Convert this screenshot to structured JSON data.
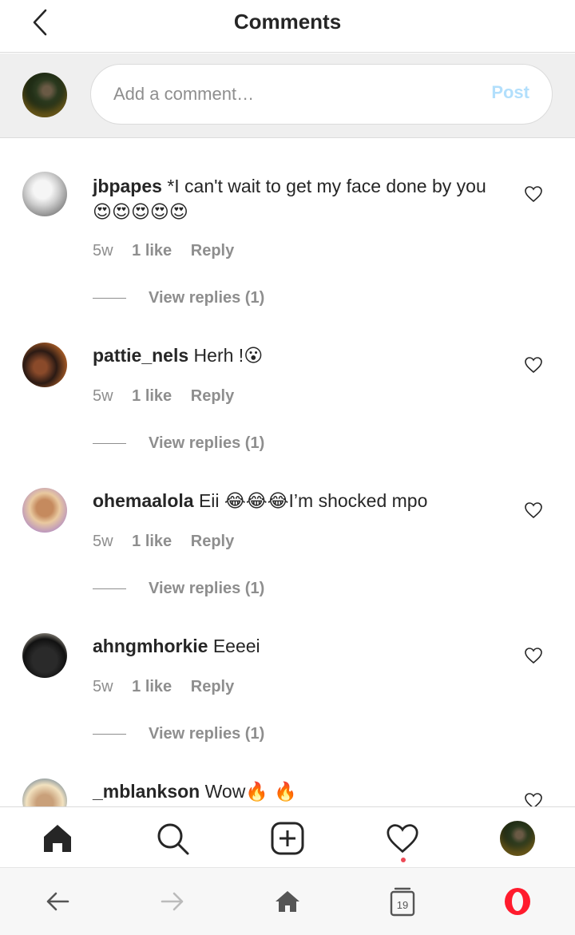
{
  "header": {
    "title": "Comments"
  },
  "composer": {
    "placeholder": "Add a comment…",
    "post_label": "Post"
  },
  "comments": [
    {
      "username": "jbpapes",
      "text": "*I can't wait to get my face done by you",
      "emoji": "😍😍😍😍😍",
      "age": "5w",
      "likes": "1 like",
      "reply": "Reply",
      "view_replies": "View replies (1)"
    },
    {
      "username": "pattie_nels",
      "text": "Herh !",
      "emoji": "😮",
      "age": "5w",
      "likes": "1 like",
      "reply": "Reply",
      "view_replies": "View replies (1)"
    },
    {
      "username": "ohemaalola",
      "text": "Eii ",
      "emoji": "😂😂😂",
      "text_after": "I’m shocked mpo",
      "age": "5w",
      "likes": "1 like",
      "reply": "Reply",
      "view_replies": "View replies (1)"
    },
    {
      "username": "ahngmhorkie",
      "text": "Eeeei",
      "age": "5w",
      "likes": "1 like",
      "reply": "Reply",
      "view_replies": "View replies (1)"
    },
    {
      "username": "_mblankson",
      "text": "Wow",
      "emoji": "🔥 🔥"
    }
  ],
  "tabbar": {
    "items": [
      "home-icon",
      "search-icon",
      "new-post-icon",
      "activity-icon",
      "profile-icon"
    ]
  },
  "browser": {
    "tabs_count": "19"
  },
  "colors": {
    "accent": "#b2dffc",
    "notification": "#ed4956",
    "opera_red": "#ff1b2d"
  }
}
